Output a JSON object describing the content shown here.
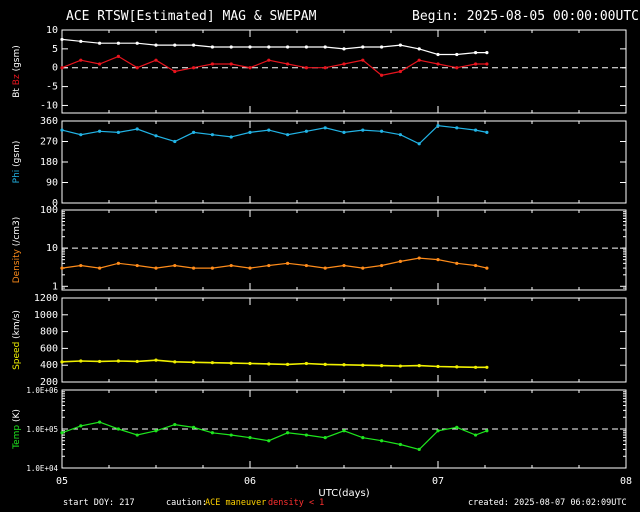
{
  "header": {
    "title": "ACE RTSW[Estimated] MAG & SWEPAM",
    "begin": "Begin: 2025-08-05 00:00:00UTC"
  },
  "footer": {
    "start_doy": "start DOY: 217",
    "caution_label": "caution:",
    "ace_maneuver": "ACE maneuver",
    "density_note": "density < 1",
    "created": "created: 2025-08-07 06:02:09UTC"
  },
  "colors": {
    "background": "#000000",
    "axes": "#ffffff",
    "bt": "#ffffff",
    "bz": "#e8141e",
    "phi": "#22b4e6",
    "density": "#ff8c1a",
    "speed": "#f0f000",
    "temp": "#1ee61e",
    "ace_maneuver": "#ffd200",
    "density_note": "#ff3030"
  },
  "chart_data": [
    {
      "type": "scatter",
      "panel": "mag",
      "ylabel": "Bt Bz (gsm)",
      "ylabel_parts": [
        "Bt",
        "Bz",
        "(gsm)"
      ],
      "ylim": [
        -12,
        10
      ],
      "yticks": [
        10,
        5,
        0,
        -5,
        -10
      ],
      "ytick_labels": [
        "10",
        "5",
        "0",
        "-5",
        "-10"
      ],
      "reference_lines": [
        0
      ],
      "series": [
        {
          "name": "Bt",
          "x": [
            0,
            0.1,
            0.2,
            0.3,
            0.4,
            0.5,
            0.6,
            0.7,
            0.8,
            0.9,
            1.0,
            1.1,
            1.2,
            1.3,
            1.4,
            1.5,
            1.6,
            1.7,
            1.8,
            1.9,
            2.0,
            2.1,
            2.2,
            2.26
          ],
          "y": [
            7.5,
            7,
            6.5,
            6.5,
            6.5,
            6,
            6,
            6,
            5.5,
            5.5,
            5.5,
            5.5,
            5.5,
            5.5,
            5.5,
            5,
            5.5,
            5.5,
            6,
            5,
            3.5,
            3.5,
            4,
            4
          ]
        },
        {
          "name": "Bz",
          "x": [
            0,
            0.1,
            0.2,
            0.3,
            0.4,
            0.5,
            0.6,
            0.7,
            0.8,
            0.9,
            1.0,
            1.1,
            1.2,
            1.3,
            1.4,
            1.5,
            1.6,
            1.7,
            1.8,
            1.9,
            2.0,
            2.1,
            2.2,
            2.26
          ],
          "y": [
            0,
            2,
            1,
            3,
            0,
            2,
            -1,
            0,
            1,
            1,
            0,
            2,
            1,
            0,
            0,
            1,
            2,
            -2,
            -1,
            2,
            1,
            0,
            1,
            1
          ]
        }
      ]
    },
    {
      "type": "scatter",
      "panel": "phi",
      "ylabel": "Phi (gsm)",
      "ylim": [
        0,
        360
      ],
      "yticks": [
        360,
        270,
        180,
        90,
        0
      ],
      "ytick_labels": [
        "360",
        "270",
        "180",
        "90",
        "0"
      ],
      "series": [
        {
          "name": "Phi",
          "x": [
            0,
            0.1,
            0.2,
            0.3,
            0.4,
            0.5,
            0.6,
            0.7,
            0.8,
            0.9,
            1.0,
            1.1,
            1.2,
            1.3,
            1.4,
            1.5,
            1.6,
            1.7,
            1.8,
            1.9,
            2.0,
            2.1,
            2.2,
            2.26
          ],
          "y": [
            320,
            300,
            315,
            310,
            325,
            295,
            270,
            310,
            300,
            290,
            310,
            320,
            300,
            315,
            330,
            310,
            320,
            315,
            300,
            260,
            340,
            330,
            320,
            310
          ]
        }
      ]
    },
    {
      "type": "scatter",
      "panel": "density",
      "ylabel": "Density (/cm3)",
      "yscale": "log",
      "ylim": [
        0.8,
        100
      ],
      "yticks": [
        100,
        10,
        1
      ],
      "ytick_labels": [
        "100",
        "10",
        "1"
      ],
      "reference_lines": [
        10
      ],
      "series": [
        {
          "name": "Density",
          "x": [
            0,
            0.1,
            0.2,
            0.3,
            0.4,
            0.5,
            0.6,
            0.7,
            0.8,
            0.9,
            1.0,
            1.1,
            1.2,
            1.3,
            1.4,
            1.5,
            1.6,
            1.7,
            1.8,
            1.9,
            2.0,
            2.1,
            2.2,
            2.26
          ],
          "y": [
            3,
            3.5,
            3,
            4,
            3.5,
            3,
            3.5,
            3,
            3,
            3.5,
            3,
            3.5,
            4,
            3.5,
            3,
            3.5,
            3,
            3.5,
            4.5,
            5.5,
            5,
            4,
            3.5,
            3
          ]
        }
      ]
    },
    {
      "type": "line",
      "panel": "speed",
      "ylabel": "Speed (km/s)",
      "ylim": [
        200,
        1200
      ],
      "yticks": [
        1200,
        1000,
        800,
        600,
        400,
        200
      ],
      "ytick_labels": [
        "1200",
        "1000",
        "800",
        "600",
        "400",
        "200"
      ],
      "series": [
        {
          "name": "Speed",
          "x": [
            0,
            0.1,
            0.2,
            0.3,
            0.4,
            0.5,
            0.6,
            0.7,
            0.8,
            0.9,
            1.0,
            1.1,
            1.2,
            1.3,
            1.4,
            1.5,
            1.6,
            1.7,
            1.8,
            1.9,
            2.0,
            2.1,
            2.2,
            2.26
          ],
          "y": [
            440,
            450,
            445,
            450,
            445,
            460,
            440,
            435,
            430,
            425,
            420,
            415,
            410,
            420,
            410,
            405,
            400,
            395,
            390,
            395,
            385,
            380,
            375,
            375
          ]
        }
      ]
    },
    {
      "type": "scatter",
      "panel": "temp",
      "ylabel": "Temp (K)",
      "yscale": "log",
      "ylim": [
        10000,
        1000000
      ],
      "yticks": [
        1000000,
        100000,
        10000
      ],
      "ytick_labels": [
        "1.0E+06",
        "1.0E+05",
        "1.0E+04"
      ],
      "reference_lines": [
        100000
      ],
      "series": [
        {
          "name": "Temp",
          "x": [
            0,
            0.1,
            0.2,
            0.3,
            0.4,
            0.5,
            0.6,
            0.7,
            0.8,
            0.9,
            1.0,
            1.1,
            1.2,
            1.3,
            1.4,
            1.5,
            1.6,
            1.7,
            1.8,
            1.9,
            2.0,
            2.1,
            2.2,
            2.26
          ],
          "y": [
            80000,
            120000,
            150000,
            100000,
            70000,
            90000,
            130000,
            110000,
            80000,
            70000,
            60000,
            50000,
            80000,
            70000,
            60000,
            90000,
            60000,
            50000,
            40000,
            30000,
            90000,
            110000,
            70000,
            90000
          ]
        }
      ]
    }
  ],
  "x_axis": {
    "xlabel": "UTC(days)",
    "xlim": [
      0,
      3
    ],
    "ticks": [
      0,
      1,
      2,
      3
    ],
    "tick_labels": [
      "05",
      "06",
      "07",
      "08"
    ]
  }
}
